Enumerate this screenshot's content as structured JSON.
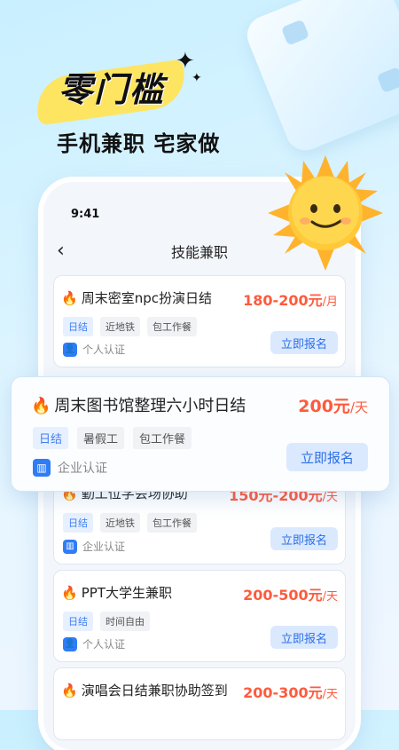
{
  "promo": {
    "headline": "零门槛",
    "subhead": "手机兼职  宅家做"
  },
  "status": {
    "time": "9:41"
  },
  "nav": {
    "title": "技能兼职"
  },
  "featured": {
    "title": "周末图书馆整理六小时日结",
    "salary": "200元",
    "unit": "/天",
    "tags": [
      "日结",
      "暑假工",
      "包工作餐"
    ],
    "cert": "企业认证",
    "button": "立即报名"
  },
  "jobs": [
    {
      "title": "周末密室npc扮演日结",
      "salary": "180-200元",
      "unit": "/月",
      "tags": [
        "日结",
        "近地铁",
        "包工作餐"
      ],
      "cert": "个人认证",
      "button": "立即报名"
    },
    {
      "title": "勤工位学会场协助",
      "salary": "150元-200元",
      "unit": "/天",
      "tags": [
        "日结",
        "近地铁",
        "包工作餐"
      ],
      "cert": "企业认证",
      "button": "立即报名"
    },
    {
      "title": "PPT大学生兼职",
      "salary": "200-500元",
      "unit": "/天",
      "tags": [
        "日结",
        "时间自由"
      ],
      "cert": "个人认证",
      "button": "立即报名"
    },
    {
      "title": "演唱会日结兼职协助签到",
      "salary": "200-300元",
      "unit": "/天",
      "tags": [],
      "cert": "",
      "button": ""
    }
  ],
  "colors": {
    "accent": "#2c6fe6",
    "salary": "#ff5a3c",
    "highlight": "#ffe45a"
  }
}
